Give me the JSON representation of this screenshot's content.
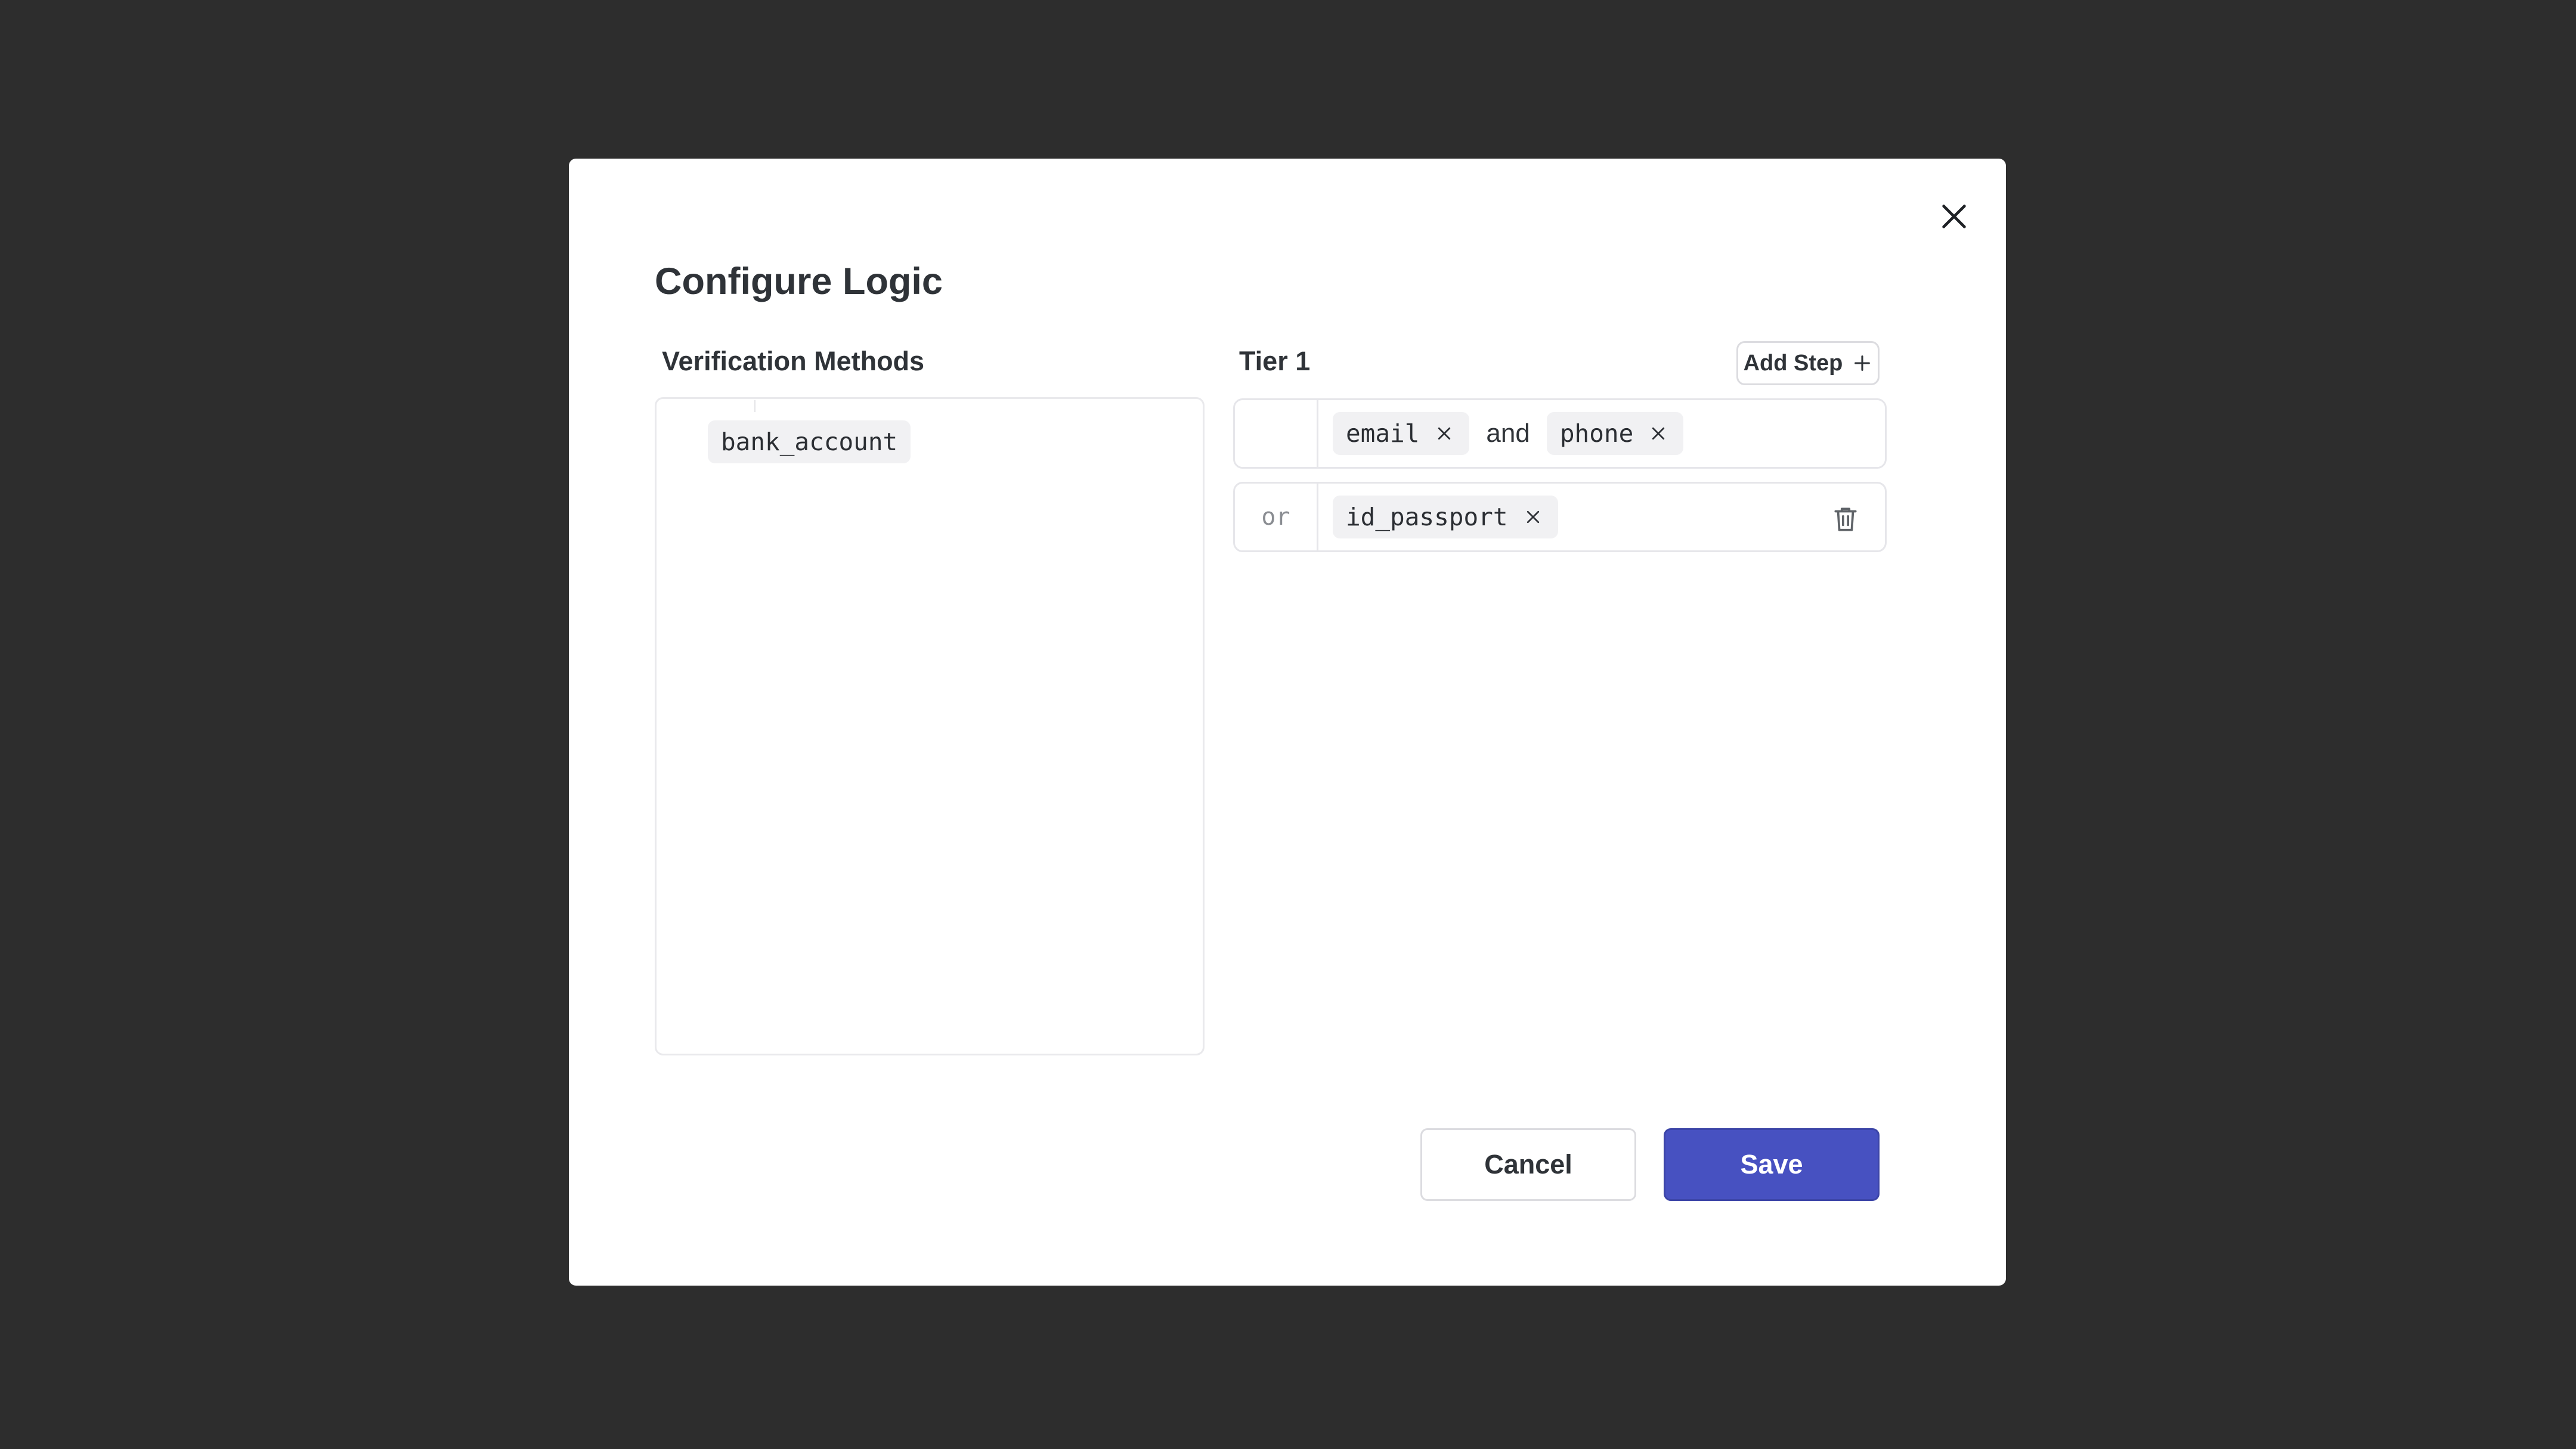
{
  "dialog": {
    "title": "Configure Logic",
    "close_icon": "close-icon"
  },
  "methods": {
    "label": "Verification Methods",
    "items": [
      "bank_account"
    ]
  },
  "tier": {
    "label": "Tier 1",
    "add_step_label": "Add Step",
    "add_step_icon": "plus-icon",
    "steps": [
      {
        "operator": "",
        "methods": [
          "email",
          "phone"
        ],
        "joiner": "and"
      },
      {
        "operator": "or",
        "methods": [
          "id_passport"
        ],
        "delete_icon": "trash-icon"
      }
    ]
  },
  "footer": {
    "cancel_label": "Cancel",
    "save_label": "Save"
  },
  "colors": {
    "backdrop": "#2d2d2d",
    "primary": "#4751c1",
    "chip_bg": "#f1f1f3"
  }
}
